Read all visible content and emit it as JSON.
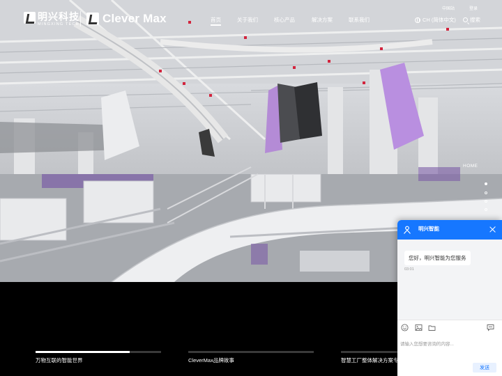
{
  "header": {
    "logo_cn": "明兴科技",
    "logo_en": "MINGXING TECH",
    "brand": "Clever Max",
    "nav": [
      {
        "label": "首页",
        "active": true
      },
      {
        "label": "关于我们",
        "active": false
      },
      {
        "label": "核心产品",
        "active": false
      },
      {
        "label": "解决方案",
        "active": false
      },
      {
        "label": "联系我们",
        "active": false
      }
    ],
    "top_links": [
      "中国站",
      "登录"
    ],
    "language": "CH (简体中文)",
    "search_label": "搜索"
  },
  "side_nav": {
    "label": "HOME",
    "dot_count": 4,
    "active_index": 0
  },
  "slides": [
    {
      "label": "万物互联的智能世界",
      "progress": 0.75
    },
    {
      "label": "CleverMax品牌故事",
      "progress": 0
    },
    {
      "label": "智慧工厂整体解决方案专家",
      "progress": 0
    }
  ],
  "chat": {
    "title": "明兴智能",
    "greeting": "您好，明兴智能为您服务",
    "time": "03:01",
    "input_placeholder": "请输入您想要咨询的内容...",
    "send_label": "发送"
  },
  "icons": {
    "brand_logo": "mingxing-logo-icon",
    "globe": "globe-icon",
    "search": "search-icon",
    "close": "close-icon",
    "emoji": "emoji-icon",
    "image": "image-icon",
    "folder": "folder-icon",
    "comment": "comment-icon"
  },
  "colors": {
    "chat_accent": "#1677ff",
    "background": "#000000",
    "text": "#ffffff"
  }
}
